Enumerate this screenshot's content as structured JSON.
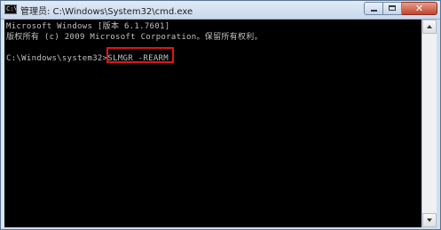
{
  "window": {
    "title": "管理员: C:\\Windows\\System32\\cmd.exe",
    "icon": "cmd-icon",
    "icon_glyph": "C:\\",
    "buttons": {
      "minimize": "minimize-icon",
      "maximize": "maximize-icon",
      "close_glyph": "✕"
    }
  },
  "console": {
    "line1": "Microsoft Windows [版本 6.1.7601]",
    "line2": "版权所有 (c) 2009 Microsoft Corporation。保留所有权利。",
    "prompt": "C:\\Windows\\system32>",
    "command": "SLMGR -REARM",
    "text_color": "#c0c0c0",
    "background": "#000000",
    "highlight_color": "#e0141c"
  }
}
